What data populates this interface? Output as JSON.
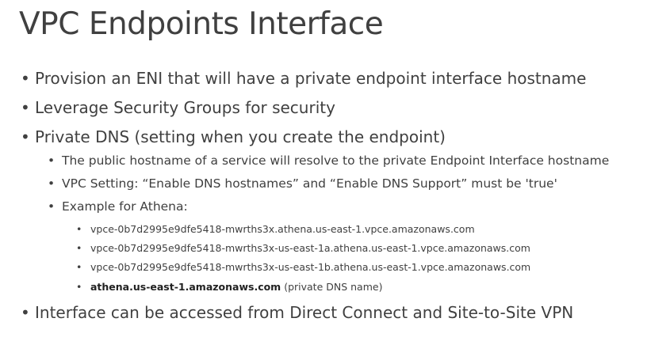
{
  "slide": {
    "title": "VPC Endpoints Interface",
    "bullet_symbol": "•",
    "bullets": {
      "b1": "Provision an ENI that will have a private endpoint interface hostname",
      "b2": "Leverage Security Groups for security",
      "b3": "Private DNS (setting when you create the endpoint)",
      "b3_1": "The public hostname of a service will resolve to the private Endpoint Interface hostname",
      "b3_2": "VPC Setting: “Enable DNS hostnames” and “Enable DNS Support” must be 'true'",
      "b3_3": "Example for Athena:",
      "b3_3_1": "vpce-0b7d2995e9dfe5418-mwrths3x.athena.us-east-1.vpce.amazonaws.com",
      "b3_3_2": "vpce-0b7d2995e9dfe5418-mwrths3x-us-east-1a.athena.us-east-1.vpce.amazonaws.com",
      "b3_3_3": "vpce-0b7d2995e9dfe5418-mwrths3x-us-east-1b.athena.us-east-1.vpce.amazonaws.com",
      "b3_3_4_bold": "athena.us-east-1.amazonaws.com",
      "b3_3_4_rest": " (private DNS name)",
      "b4": "Interface can be accessed from Direct Connect and Site-to-Site VPN"
    }
  }
}
